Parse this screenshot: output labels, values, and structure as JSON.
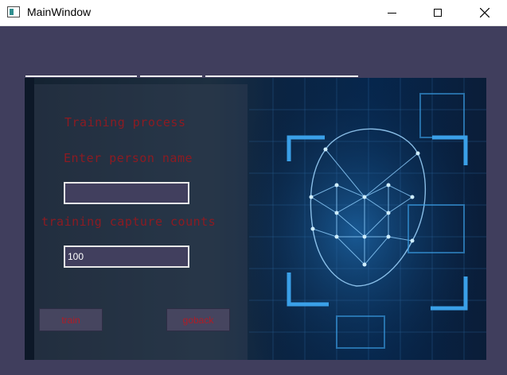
{
  "window": {
    "title": "MainWindow",
    "icon": "app-window-icon"
  },
  "form": {
    "heading": "Training process",
    "name_label": "Enter person name",
    "name_value": "",
    "count_label": "training capture counts",
    "count_value": "100"
  },
  "buttons": {
    "train": "train",
    "goback": "goback"
  },
  "colors": {
    "background": "#403e5d",
    "label_red": "#8c1b22",
    "input_border": "#e8e8e8",
    "button_bg": "#46455f",
    "face_accent": "#3aa0e8"
  }
}
